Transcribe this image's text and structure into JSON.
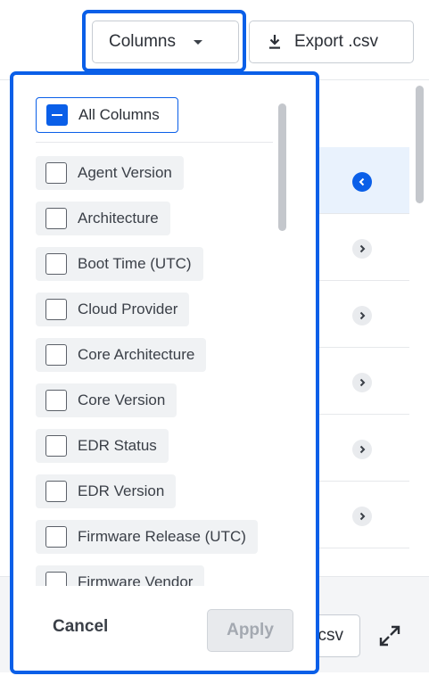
{
  "toolbar": {
    "columns_label": "Columns",
    "export_label": "Export .csv"
  },
  "background": {
    "export_peek_label": "csv"
  },
  "columns_menu": {
    "all_columns_label": "All Columns",
    "options": [
      "Agent Version",
      "Architecture",
      "Boot Time (UTC)",
      "Cloud Provider",
      "Core Architecture",
      "Core Version",
      "EDR Status",
      "EDR Version",
      "Firmware Release (UTC)",
      "Firmware Vendor"
    ],
    "cancel_label": "Cancel",
    "apply_label": "Apply"
  },
  "colors": {
    "accent": "#0a5fe8",
    "selected_row": "#e9f2fd",
    "option_bg": "#f0f2f4"
  }
}
